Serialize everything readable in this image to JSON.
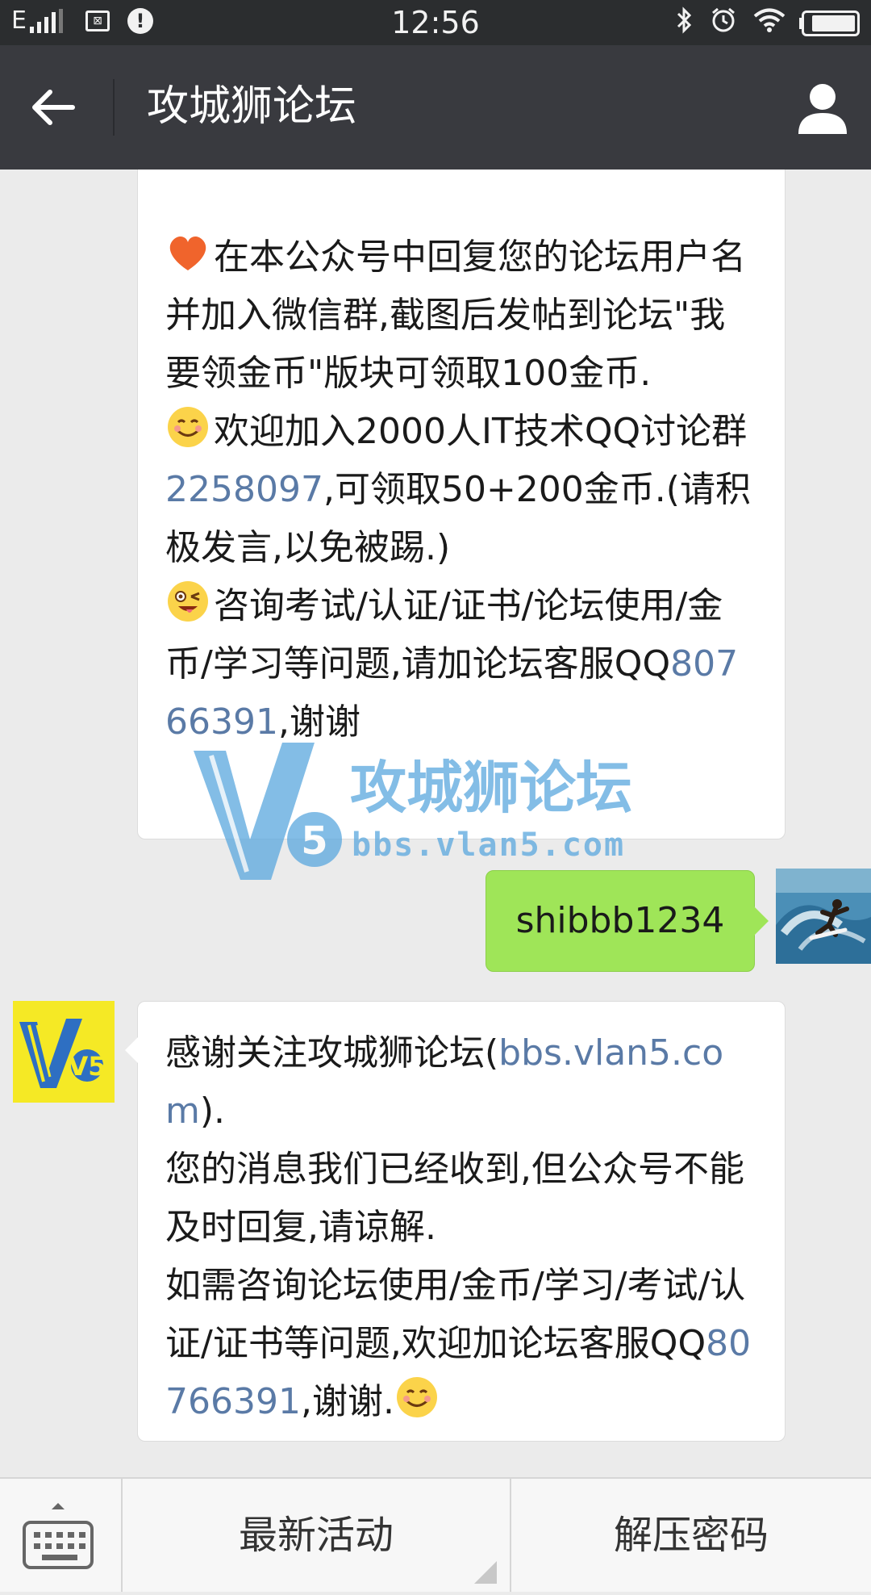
{
  "status_bar": {
    "network": "E",
    "time": "12:56"
  },
  "header": {
    "title": "攻城狮论坛"
  },
  "messages": {
    "m1": {
      "p1_text": "在本公众号中回复您的论坛用户名并加入微信群,截图后发帖到论坛\"我要领金币\"版块可领取100金币.",
      "p2_pre": "欢迎加入2000人IT技术QQ讨论群",
      "p2_link": "2258097",
      "p2_post": ",可领取50+200金币.(请积极发言,以免被踢.)",
      "p3_pre": "咨询考试/认证/证书/论坛使用/金币/学习等问题,请加论坛客服QQ",
      "p3_link": "80766391",
      "p3_post": ",谢谢"
    },
    "m2": {
      "text": "shibbb1234"
    },
    "m3": {
      "l1_pre": "感谢关注攻城狮论坛(",
      "l1_link": "bbs.vlan5.com",
      "l1_post": ").",
      "l2": "您的消息我们已经收到,但公众号不能及时回复,请谅解.",
      "l3_pre": "如需咨询论坛使用/金币/学习/考试/认证/证书等问题,欢迎加论坛客服QQ",
      "l3_link": "80766391",
      "l3_post": ",谢谢."
    }
  },
  "watermark": {
    "logo": "V5",
    "name": "攻城狮论坛",
    "url": "bbs.vlan5.com"
  },
  "bot_avatar": {
    "logo": "V5"
  },
  "bottom_menu": {
    "item1": "最新活动",
    "item2": "解压密码"
  },
  "colors": {
    "link": "#5a7aa6",
    "sent_bubble": "#9fe558",
    "title_bar": "#393a3f"
  }
}
